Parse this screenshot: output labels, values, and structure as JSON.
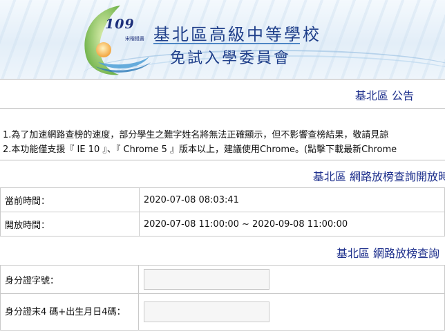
{
  "header": {
    "logo_year": "109",
    "logo_tagline": "宋楷錢書",
    "org_name": "基北區高級中等學校",
    "committee": "免試入學委員會"
  },
  "announcement": {
    "title": "基北區 公告"
  },
  "notices": [
    "1.為了加速網路查榜的速度，部分學生之難字姓名將無法正確顯示，但不影響查榜結果，敬請見諒",
    "2.本功能僅支援『 IE 10 』、『 Chrome 5 』版本以上，建議使用Chrome。(點擊下載最新Chrome"
  ],
  "open_period": {
    "title": "基北區 網路放榜查詢開放時",
    "rows": [
      {
        "label": "當前時間：",
        "value": "2020-07-08 08:03:41"
      },
      {
        "label": "開放時間：",
        "value": "2020-07-08 11:00:00 ~ 2020-09-08 11:00:00"
      }
    ]
  },
  "query": {
    "title": "基北區 網路放榜查詢",
    "id_label": "身分證字號：",
    "id_value": "",
    "dob_label": "身分證末4 碼+出生月日4碼：",
    "dob_value": ""
  },
  "colors": {
    "heading_blue": "#1d2f8c",
    "border_gray": "#c9c9c9"
  }
}
